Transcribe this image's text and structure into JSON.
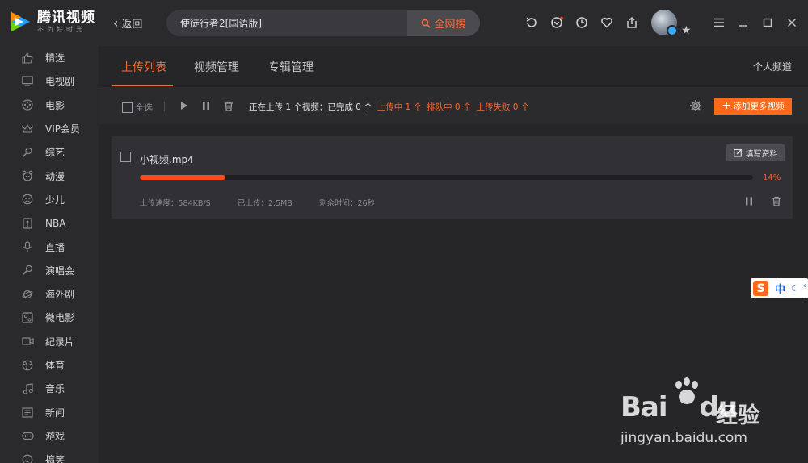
{
  "app": {
    "logo_title": "腾讯视频",
    "logo_subtitle": "不负好时光"
  },
  "topbar": {
    "back_label": "返回",
    "search_value": "使徒行者2[国语版]",
    "search_button_label": "全网搜",
    "tool_icons": [
      "history-icon",
      "favorites-icon",
      "clock-icon",
      "heart-icon",
      "upload-icon"
    ]
  },
  "sidebar": {
    "items": [
      {
        "label": "精选",
        "icon": "thumbs-up-icon"
      },
      {
        "label": "电视剧",
        "icon": "tv-icon"
      },
      {
        "label": "电影",
        "icon": "film-reel-icon"
      },
      {
        "label": "VIP会员",
        "icon": "vip-crown-icon"
      },
      {
        "label": "综艺",
        "icon": "microphone-star-icon"
      },
      {
        "label": "动漫",
        "icon": "cartoon-icon"
      },
      {
        "label": "少儿",
        "icon": "kid-face-icon"
      },
      {
        "label": "NBA",
        "icon": "nba-icon"
      },
      {
        "label": "直播",
        "icon": "mic-icon"
      },
      {
        "label": "演唱会",
        "icon": "concert-mic-icon"
      },
      {
        "label": "海外剧",
        "icon": "planet-icon"
      },
      {
        "label": "微电影",
        "icon": "projector-icon"
      },
      {
        "label": "纪录片",
        "icon": "camera-icon"
      },
      {
        "label": "体育",
        "icon": "ball-icon"
      },
      {
        "label": "音乐",
        "icon": "music-note-icon"
      },
      {
        "label": "新闻",
        "icon": "newspaper-icon"
      },
      {
        "label": "游戏",
        "icon": "gamepad-icon"
      },
      {
        "label": "搞笑",
        "icon": "smile-icon"
      }
    ]
  },
  "tabs": {
    "items": [
      "上传列表",
      "视频管理",
      "专辑管理"
    ],
    "active_index": 0,
    "channel_label": "个人频道"
  },
  "toolbar": {
    "select_all_label": "全选",
    "status_main": "正在上传 1 个视频：已完成 0 个",
    "status_uploading": "上传中 1 个",
    "status_queued": "排队中 0 个",
    "status_failed": "上传失败 0 个",
    "add_button_label": "添加更多视频"
  },
  "upload_item": {
    "file_name": "小视频.mp4",
    "fill_info_label": "填写资料",
    "progress_percent": 14,
    "progress_label": "14%",
    "speed": "上传速度：584KB/S",
    "uploaded": "已上传：2.5MB",
    "remaining": "剩余时间：26秒"
  },
  "ime": {
    "logo": "S",
    "mode": "中"
  },
  "watermark": {
    "brand_left": "Bai",
    "brand_right": "du",
    "brand_cn": "经验",
    "url": "jingyan.baidu.com"
  },
  "colors": {
    "accent": "#ff6a2b",
    "progress": "#ff4a1a",
    "background": "#262629",
    "panel": "#2a2a2d"
  }
}
